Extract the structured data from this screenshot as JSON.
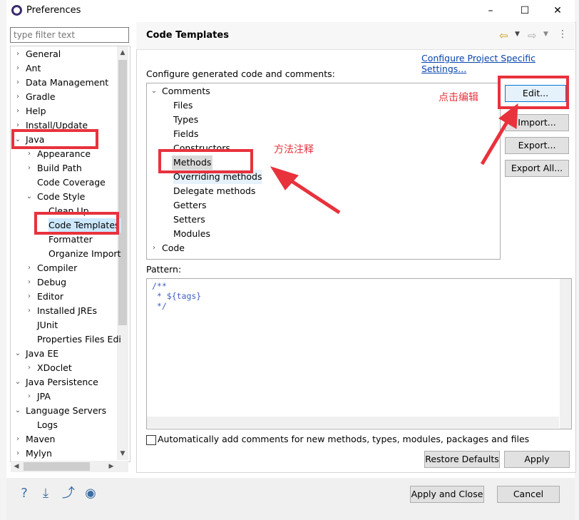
{
  "window": {
    "title": "Preferences",
    "minimize": "–",
    "maximize": "☐",
    "close": "✕"
  },
  "filter": {
    "placeholder": "type filter text"
  },
  "tree_items": [
    {
      "label": "General",
      "arrow": "›"
    },
    {
      "label": "Ant",
      "arrow": "›"
    },
    {
      "label": "Data Management",
      "arrow": "›"
    },
    {
      "label": "Gradle",
      "arrow": "›"
    },
    {
      "label": "Help",
      "arrow": "›"
    },
    {
      "label": "Install/Update",
      "arrow": "›"
    },
    {
      "label": "Java",
      "arrow": "⌄"
    },
    {
      "label": "Appearance",
      "arrow": "›"
    },
    {
      "label": "Build Path",
      "arrow": "›"
    },
    {
      "label": "Code Coverage",
      "arrow": ""
    },
    {
      "label": "Code Style",
      "arrow": "⌄"
    },
    {
      "label": "Clean Up",
      "arrow": ""
    },
    {
      "label": "Code Templates",
      "arrow": ""
    },
    {
      "label": "Formatter",
      "arrow": ""
    },
    {
      "label": "Organize Import",
      "arrow": ""
    },
    {
      "label": "Compiler",
      "arrow": "›"
    },
    {
      "label": "Debug",
      "arrow": "›"
    },
    {
      "label": "Editor",
      "arrow": "›"
    },
    {
      "label": "Installed JREs",
      "arrow": "›"
    },
    {
      "label": "JUnit",
      "arrow": ""
    },
    {
      "label": "Properties Files Edi",
      "arrow": ""
    },
    {
      "label": "Java EE",
      "arrow": "⌄"
    },
    {
      "label": "XDoclet",
      "arrow": "›"
    },
    {
      "label": "Java Persistence",
      "arrow": "⌄"
    },
    {
      "label": "JPA",
      "arrow": "›"
    },
    {
      "label": "Language Servers",
      "arrow": "⌄"
    },
    {
      "label": "Logs",
      "arrow": ""
    },
    {
      "label": "Maven",
      "arrow": "›"
    },
    {
      "label": "Mylyn",
      "arrow": "›"
    }
  ],
  "panel": {
    "title": "Code Templates",
    "config_link": "Configure Project Specific Settings...",
    "config_label": "Configure generated code and comments:",
    "pattern_label": "Pattern:",
    "pattern_code": "/**\n * ${tags}\n */"
  },
  "templates": [
    {
      "label": "Comments",
      "arrow": "⌄"
    },
    {
      "label": "Files",
      "arrow": ""
    },
    {
      "label": "Types",
      "arrow": ""
    },
    {
      "label": "Fields",
      "arrow": ""
    },
    {
      "label": "Constructors",
      "arrow": ""
    },
    {
      "label": "Methods",
      "arrow": ""
    },
    {
      "label": "Overriding methods",
      "arrow": ""
    },
    {
      "label": "Delegate methods",
      "arrow": ""
    },
    {
      "label": "Getters",
      "arrow": ""
    },
    {
      "label": "Setters",
      "arrow": ""
    },
    {
      "label": "Modules",
      "arrow": ""
    },
    {
      "label": "Code",
      "arrow": "›"
    }
  ],
  "buttons": {
    "edit": "Edit...",
    "import": "Import...",
    "export": "Export...",
    "export_all": "Export All...",
    "restore": "Restore Defaults",
    "apply": "Apply",
    "apply_close": "Apply and Close",
    "cancel": "Cancel"
  },
  "checkbox_label": "Automatically add comments for new methods, types, modules, packages and files",
  "annotations": {
    "edit_note": "点击编辑",
    "method_note": "方法注释"
  },
  "colors": {
    "annotation": "#e8323c",
    "link": "#0645ad"
  }
}
